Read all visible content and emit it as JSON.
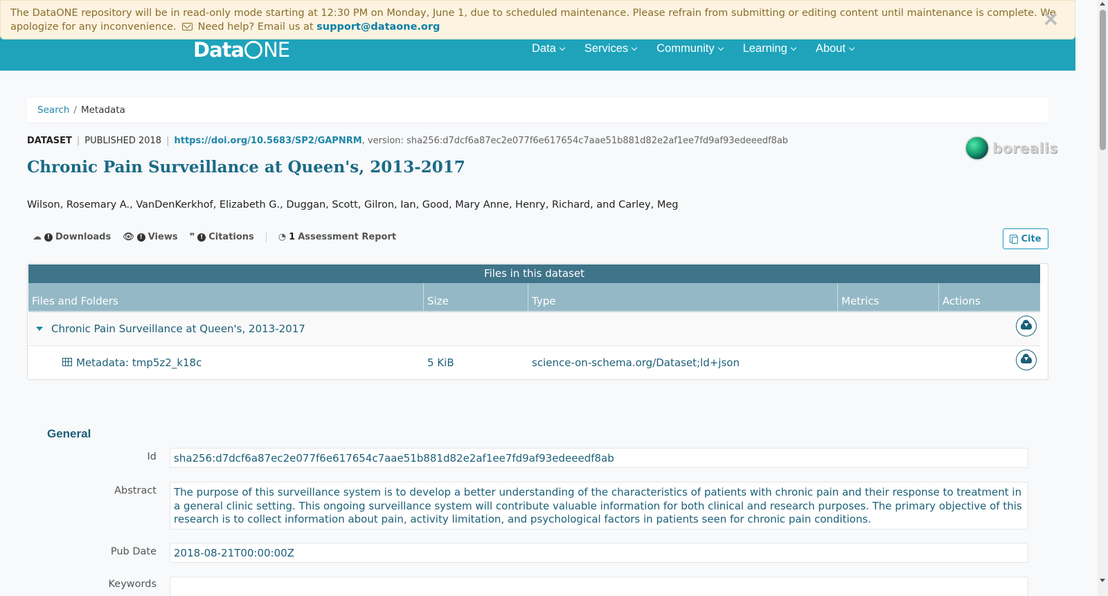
{
  "banner": {
    "message": "The DataONE repository will be in read-only mode starting at 12:30 PM on Monday, June 1, due to scheduled maintenance. Please refrain from submitting or editing content until maintenance is complete. We apologize for any inconvenience.",
    "help_text": "Need help? Email us at",
    "help_email": "support@dataone.org",
    "close_label": "×"
  },
  "header": {
    "logo_data": "Data",
    "logo_ne": "NE",
    "nav": [
      {
        "label": "Data"
      },
      {
        "label": "Services"
      },
      {
        "label": "Community"
      },
      {
        "label": "Learning"
      },
      {
        "label": "About"
      }
    ]
  },
  "breadcrumb": {
    "search": "Search",
    "separator": "/",
    "current": "Metadata"
  },
  "dataset": {
    "type": "DATASET",
    "published": "PUBLISHED 2018",
    "doi": "https://doi.org/10.5683/SP2/GAPNRM",
    "version": ", version: sha256:d7dcf6a87ec2e077f6e617654c7aae51b881d82e2af1ee7fd9af93edeeedf8ab",
    "title": "Chronic Pain Surveillance at Queen's, 2013-2017",
    "authors": "Wilson, Rosemary A., VanDenKerkhof, Elizabeth G., Duggan, Scott, Gilron, Ian, Good, Mary Anne, Henry, Richard, and Carley, Meg",
    "repository_logo_text": "borealis"
  },
  "metrics": {
    "downloads_label": "Downloads",
    "views_label": "Views",
    "citations_label": "Citations",
    "assessment_count": "1",
    "assessment_label": "Assessment Report",
    "cite_label": "Cite"
  },
  "files": {
    "caption": "Files in this dataset",
    "columns": [
      "Files and Folders",
      "Size",
      "Type",
      "Metrics",
      "Actions"
    ],
    "folder": {
      "name": "Chronic Pain Surveillance at Queen's, 2013-2017"
    },
    "file": {
      "name": "Metadata: tmp5z2_k18c",
      "size": "5 KiB",
      "type": "science-on-schema.org/Dataset;ld+json"
    }
  },
  "general": {
    "title": "General",
    "id_label": "Id",
    "id_value": "sha256:d7dcf6a87ec2e077f6e617654c7aae51b881d82e2af1ee7fd9af93edeeedf8ab",
    "abstract_label": "Abstract",
    "abstract_value": "The purpose of this surveillance system is to develop a better understanding of the characteristics of patients with chronic pain and their response to treatment in a general clinic setting. This ongoing surveillance system will contribute valuable information for both clinical and research purposes. The primary objective of this research is to collect information about pain, activity limitation, and psychological factors in patients seen for chronic pain conditions.",
    "pubdate_label": "Pub Date",
    "pubdate_value": "2018-08-21T00:00:00Z",
    "keywords_label": "Keywords"
  },
  "colors": {
    "header_bg": "#1ea3bb",
    "accent": "#1b6a87",
    "table_caption": "#3f7489",
    "table_header": "#94b8c6",
    "banner_bg": "#fcf3e0"
  }
}
